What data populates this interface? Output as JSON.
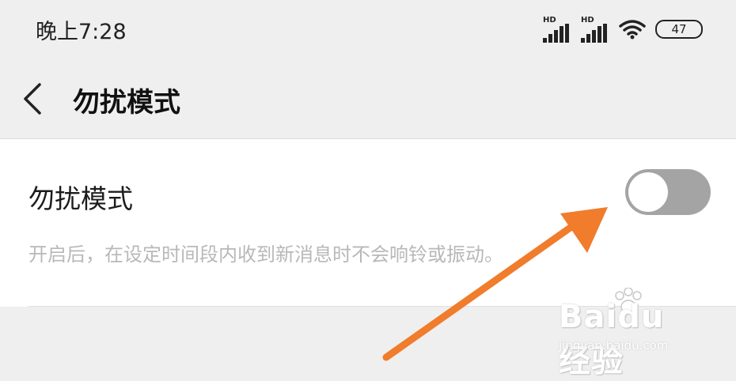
{
  "status_bar": {
    "time": "晚上7:28",
    "signal_1_label": "HD",
    "signal_2_label": "HD",
    "wifi_icon": "wifi-icon",
    "battery_level": "47"
  },
  "app_bar": {
    "back_icon": "chevron-left-icon",
    "title": "勿扰模式"
  },
  "setting": {
    "title": "勿扰模式",
    "description": "开启后，在设定时间段内收到新消息时不会响铃或振动。",
    "toggle_state": "off"
  },
  "annotation": {
    "arrow_color": "#f07c2c",
    "arrow_points_to": "do-not-disturb-toggle"
  },
  "watermark": {
    "logo_text": "Baidu 经验",
    "url_text": "jingyan.baidu.com"
  },
  "colors": {
    "background": "#efefef",
    "card": "#ffffff",
    "toggle_off": "#a4a4a4",
    "description_text": "#b8b8b8"
  }
}
